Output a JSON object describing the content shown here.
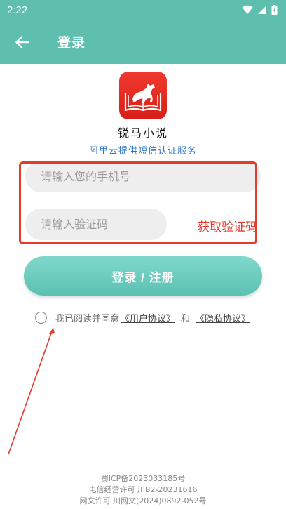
{
  "status_bar": {
    "time": "2:22"
  },
  "app_bar": {
    "title": "登录"
  },
  "logo": {
    "app_name": "锐马小说",
    "sms_provider": "阿里云提供短信认证服务"
  },
  "form": {
    "phone_placeholder": "请输入您的手机号",
    "code_placeholder": "请输入验证码",
    "get_code_label": "获取验证码",
    "login_label": "登录 / 注册"
  },
  "agreement": {
    "prefix": "我已阅读并同意",
    "user_agreement": "《用户协议》",
    "conjunction": "和",
    "privacy_policy": "《隐私协议》"
  },
  "footer": {
    "icp": "蜀ICP备2023033185号",
    "telecom": "电信经营许可 川B2-20231616",
    "culture": "网文许可 川网文(2024)0892-052号"
  },
  "colors": {
    "primary": "#5fbfae",
    "accent_red": "#e3392e",
    "link_blue": "#2e74c9"
  }
}
